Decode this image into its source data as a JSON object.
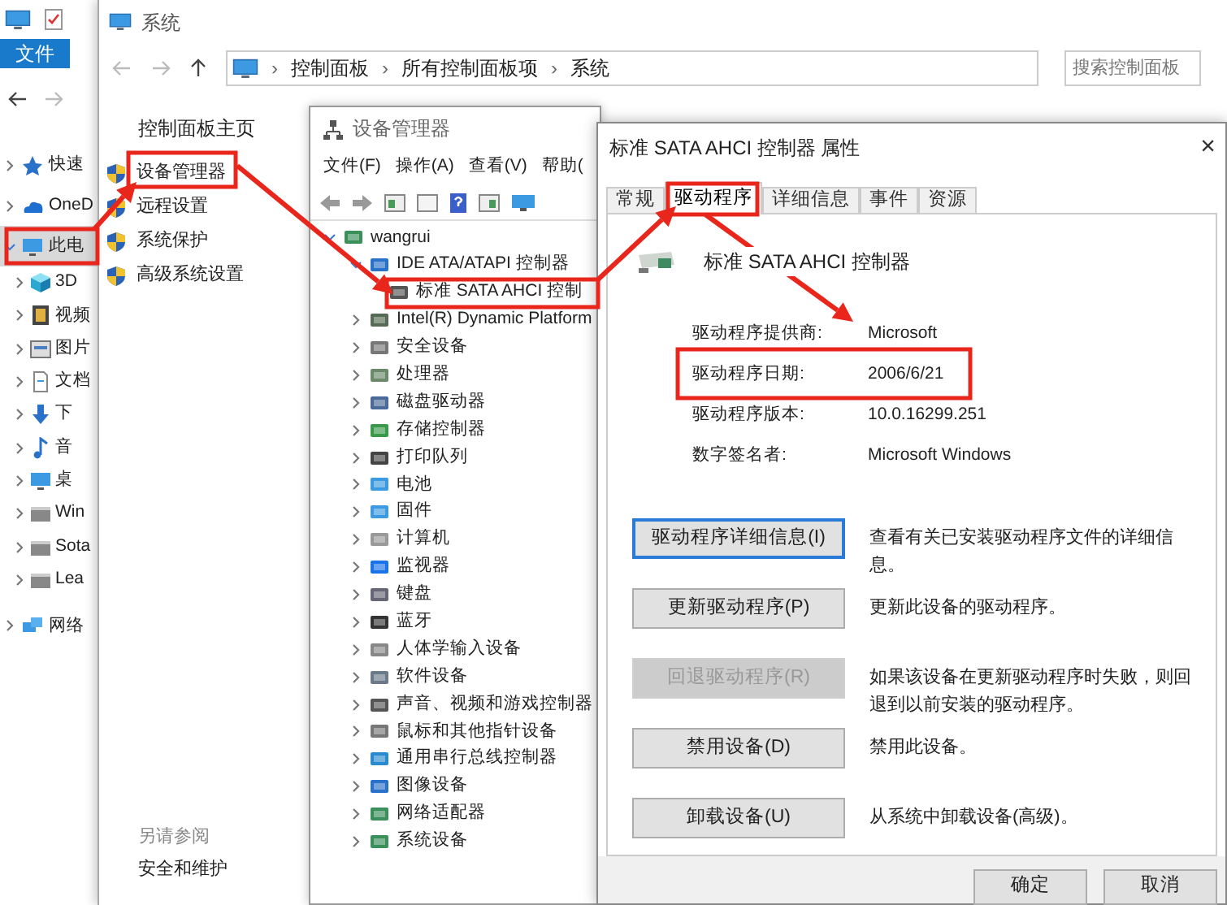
{
  "explorer": {
    "ribbon_tab": "文件",
    "nav": [
      {
        "label": "快速",
        "expanded": false,
        "selected": false
      },
      {
        "label": "OneD",
        "expanded": false,
        "selected": false
      },
      {
        "label": "此电",
        "expanded": true,
        "selected": true,
        "children": [
          {
            "label": "3D",
            "expanded": false
          },
          {
            "label": "视频",
            "expanded": false
          },
          {
            "label": "图片",
            "expanded": false
          },
          {
            "label": "文档",
            "expanded": false
          },
          {
            "label": "下",
            "expanded": false
          },
          {
            "label": "音",
            "expanded": false
          },
          {
            "label": "桌",
            "expanded": false
          },
          {
            "label": "Win",
            "expanded": false
          },
          {
            "label": "Sota",
            "expanded": false
          },
          {
            "label": "Lea",
            "expanded": false
          }
        ]
      },
      {
        "label": "网络",
        "expanded": false,
        "selected": false
      }
    ]
  },
  "system_window": {
    "title": "系统",
    "separator": "›",
    "breadcrumb": [
      "控制面板",
      "所有控制面板项",
      "系统"
    ],
    "search": {
      "placeholder": "搜索控制面板"
    },
    "home_link": "控制面板主页",
    "links": [
      "设备管理器",
      "远程设置",
      "系统保护",
      "高级系统设置"
    ],
    "see_also": {
      "heading": "另请参阅",
      "links": [
        "安全和维护"
      ]
    }
  },
  "device_manager": {
    "title": "设备管理器",
    "menu": [
      "文件(F)",
      "操作(A)",
      "查看(V)",
      "帮助("
    ],
    "tree": {
      "label": "wangrui",
      "expanded": true,
      "children": [
        {
          "label": "IDE ATA/ATAPI 控制器",
          "expanded": true,
          "children": [
            {
              "label": "标准 SATA AHCI 控制"
            }
          ]
        },
        {
          "label": "Intel(R) Dynamic Platform",
          "expanded": false
        },
        {
          "label": "安全设备",
          "expanded": false
        },
        {
          "label": "处理器",
          "expanded": false
        },
        {
          "label": "磁盘驱动器",
          "expanded": false
        },
        {
          "label": "存储控制器",
          "expanded": false
        },
        {
          "label": "打印队列",
          "expanded": false
        },
        {
          "label": "电池",
          "expanded": false
        },
        {
          "label": "固件",
          "expanded": false
        },
        {
          "label": "计算机",
          "expanded": false
        },
        {
          "label": "监视器",
          "expanded": false
        },
        {
          "label": "键盘",
          "expanded": false
        },
        {
          "label": "蓝牙",
          "expanded": false
        },
        {
          "label": "人体学输入设备",
          "expanded": false
        },
        {
          "label": "软件设备",
          "expanded": false
        },
        {
          "label": "声音、视频和游戏控制器",
          "expanded": false
        },
        {
          "label": "鼠标和其他指针设备",
          "expanded": false
        },
        {
          "label": "通用串行总线控制器",
          "expanded": false
        },
        {
          "label": "图像设备",
          "expanded": false
        },
        {
          "label": "网络适配器",
          "expanded": false
        },
        {
          "label": "系统设备",
          "expanded": false
        }
      ]
    }
  },
  "properties": {
    "title": "标准 SATA AHCI 控制器 属性",
    "close": "×",
    "tabs": [
      {
        "label": "常规",
        "selected": false
      },
      {
        "label": "驱动程序",
        "selected": true
      },
      {
        "label": "详细信息",
        "selected": false
      },
      {
        "label": "事件",
        "selected": false
      },
      {
        "label": "资源",
        "selected": false
      }
    ],
    "device_name": "标准 SATA AHCI 控制器",
    "fields": [
      {
        "label": "驱动程序提供商:",
        "value": "Microsoft"
      },
      {
        "label": "驱动程序日期:",
        "value": "2006/6/21"
      },
      {
        "label": "驱动程序版本:",
        "value": "10.0.16299.251"
      },
      {
        "label": "数字签名者:",
        "value": "Microsoft Windows"
      }
    ],
    "actions": [
      {
        "label": "驱动程序详细信息(I)",
        "description": "查看有关已安装驱动程序文件的详细信息。",
        "disabled": false,
        "focused": true
      },
      {
        "label": "更新驱动程序(P)",
        "description": "更新此设备的驱动程序。",
        "disabled": false,
        "focused": false
      },
      {
        "label": "回退驱动程序(R)",
        "description": "如果该设备在更新驱动程序时失败，则回退到以前安装的驱动程序。",
        "disabled": true,
        "focused": false
      },
      {
        "label": "禁用设备(D)",
        "description": "禁用此设备。",
        "disabled": false,
        "focused": false
      },
      {
        "label": "卸载设备(U)",
        "description": "从系统中卸载设备(高级)。",
        "disabled": false,
        "focused": false
      }
    ],
    "buttons": [
      "确定",
      "取消"
    ]
  }
}
